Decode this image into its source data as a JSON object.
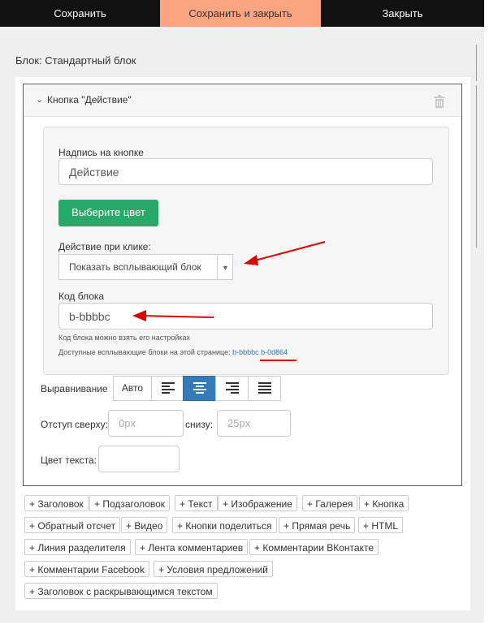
{
  "topbar": {
    "save": "Сохранить",
    "save_close": "Сохранить и закрыть",
    "close": "Закрыть"
  },
  "block_title": "Блок: Стандартный блок",
  "widget": {
    "title": "Кнопка \"Действие\"",
    "button_text_label": "Надпись на кнопке",
    "button_text_value": "Действие",
    "color_button": "Выберите цвет",
    "click_action_label": "Действие при клике:",
    "click_action_value": "Показать всплывающий блок",
    "block_code_label": "Код блока",
    "block_code_value": "b-bbbbc",
    "hint_1": "Код блока можно взять его настройках",
    "hint_2": "Доступные всплывающие блоки на этой странице:",
    "popup_codes": [
      "b-bbbbc",
      "b-0d864"
    ]
  },
  "alignment": {
    "label": "Выравнивание",
    "auto": "Авто",
    "options": [
      "left",
      "center",
      "right",
      "justify"
    ],
    "active": "center"
  },
  "margins": {
    "top_label": "Отступ сверху:",
    "top_placeholder": "0px",
    "bottom_label": "снизу:",
    "bottom_placeholder": "25px"
  },
  "text_color_label": "Цвет текста:",
  "add_buttons": [
    "+ Заголовок",
    "+ Подзаголовок",
    "+ Текст",
    "+ Изображение",
    "+ Галерея",
    "+ Кнопка",
    "+ Обратный отсчет",
    "+ Видео",
    "+ Кнопки поделиться",
    "+ Прямая речь",
    "+ HTML",
    "+ Линия разделителя",
    "+ Лента комментариев",
    "+ Комментарии ВКонтакте",
    "+ Комментарии Facebook",
    "+ Условия предложений",
    "+ Заголовок с раскрывающимся текстом"
  ],
  "colors": {
    "accent": "#fba580",
    "green": "#2aa869",
    "active_blue": "#337ab7",
    "annotation_red": "#dd0000"
  }
}
